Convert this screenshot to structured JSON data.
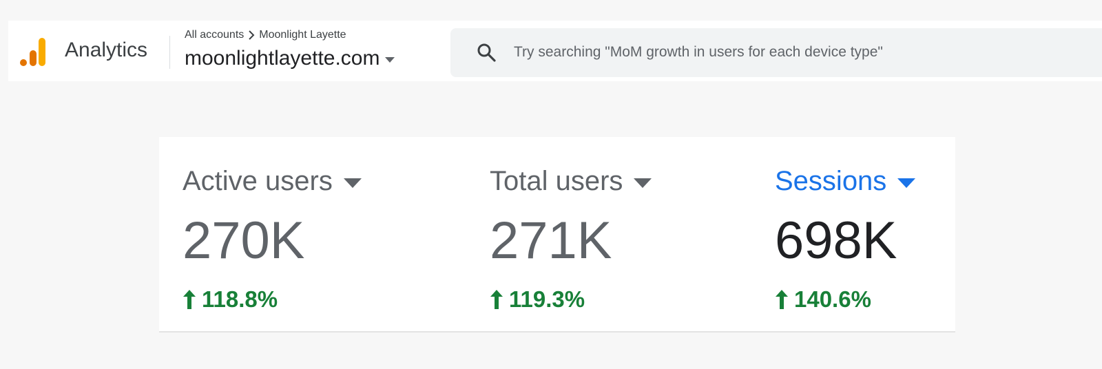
{
  "header": {
    "app_name": "Analytics",
    "breadcrumb": {
      "root": "All accounts",
      "account": "Moonlight Layette"
    },
    "property": "moonlightlayette.com",
    "search": {
      "placeholder": "Try searching \"MoM growth in users for each device type\""
    }
  },
  "colors": {
    "logo_orange": "#e37400",
    "logo_yellow": "#f9ab00",
    "accent_blue": "#1a73e8",
    "positive_green": "#188038"
  },
  "metrics": [
    {
      "label": "Active users",
      "value": "270K",
      "change": "118.8%",
      "selected": false,
      "trend_icon": "arrow-up-icon"
    },
    {
      "label": "Total users",
      "value": "271K",
      "change": "119.3%",
      "selected": false,
      "trend_icon": "arrow-up-icon"
    },
    {
      "label": "Sessions",
      "value": "698K",
      "change": "140.6%",
      "selected": true,
      "trend_icon": "arrow-up-icon"
    }
  ]
}
